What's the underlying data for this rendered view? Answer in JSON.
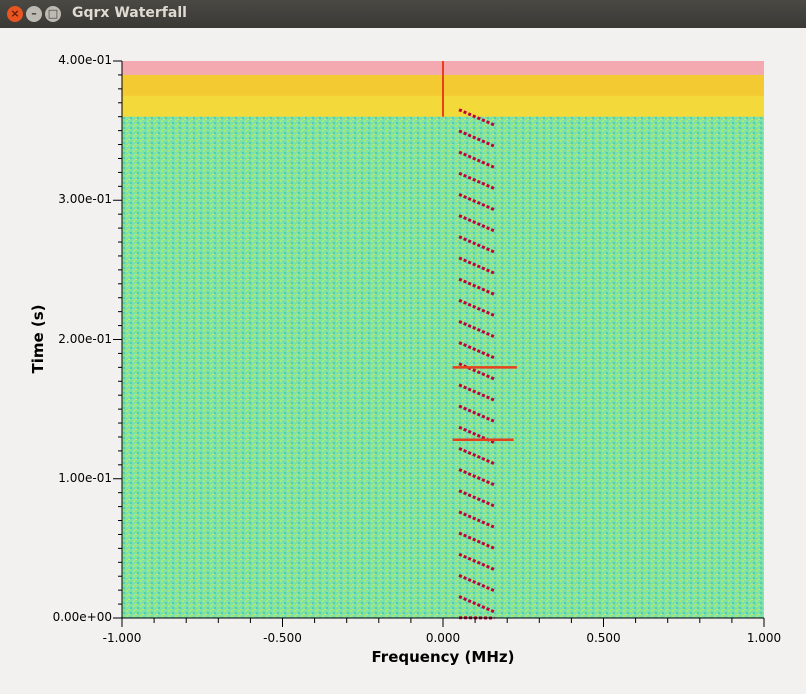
{
  "window": {
    "title": "Gqrx Waterfall",
    "close_glyph": "×",
    "min_glyph": "–",
    "max_glyph": "□",
    "icons": [
      "close-icon",
      "minimize-icon",
      "maximize-icon"
    ]
  },
  "chart_data": {
    "type": "heatmap",
    "title": "",
    "xlabel": "Frequency (MHz)",
    "ylabel": "Time (s)",
    "xlim": [
      -1.0,
      1.0
    ],
    "ylim": [
      0.0,
      0.4
    ],
    "x_ticks": [
      "-1.000",
      "-0.500",
      "0.000",
      "0.500",
      "1.000"
    ],
    "x_tick_values": [
      -1.0,
      -0.5,
      0.0,
      0.5,
      1.0
    ],
    "y_ticks": [
      "0.00e+00",
      "1.00e-01",
      "2.00e-01",
      "3.00e-01",
      "4.00e-01"
    ],
    "y_tick_values": [
      0.0,
      0.1,
      0.2,
      0.3,
      0.4
    ],
    "grid": false,
    "colormap": [
      "#2ec4b6",
      "#5fe3a1",
      "#b8f05a",
      "#f2f23a",
      "#f5b82a",
      "#e8401c",
      "#c0003a"
    ],
    "background_color": "#7fe0a8",
    "upper_band_color": "#f4d93a",
    "top_strip_color": "#f4a9b0",
    "upper_band_range_s": [
      0.36,
      0.39
    ],
    "chirps": {
      "start_freq_mhz": 0.05,
      "end_freq_mhz": 0.16,
      "period_s": 0.0152,
      "duration_s": 0.011,
      "time_range_s": [
        0.0,
        0.365
      ]
    },
    "carrier_lines": [
      {
        "time_s": 0.18,
        "freq_range_mhz": [
          0.03,
          0.23
        ]
      },
      {
        "time_s": 0.128,
        "freq_range_mhz": [
          0.03,
          0.22
        ]
      }
    ],
    "dc_line": {
      "freq_mhz": 0.0,
      "time_range_s": [
        0.36,
        0.4
      ]
    }
  }
}
